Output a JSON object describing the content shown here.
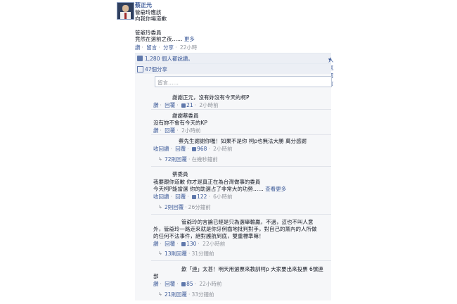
{
  "post": {
    "author": "蔡正元",
    "lines": [
      "管爺玲應該",
      "向我你場道歉",
      "",
      "管爺玲委員",
      "竟然在選前之夜……"
    ],
    "more": "更多",
    "like": "讚",
    "comment": "留言",
    "share": "分享",
    "time": "22小時"
  },
  "stats": {
    "likes_text": "1,280 個人都說讚。",
    "sort_label": "人氣留言",
    "shares_text": "47個分享"
  },
  "comment_box": {
    "placeholder": "留言……"
  },
  "comments": [
    {
      "name": "",
      "text": "謝謝正元，沒有妳沒有今天的柯P",
      "a1": "讚",
      "a2": "回覆",
      "likes": "21",
      "time": "2小時前"
    },
    {
      "name": "",
      "text": "謝謝蔡委員",
      "text2": "沒有妳不會有今天的KP",
      "a1": "讚",
      "a2": "回覆",
      "likes": "",
      "time": "2小時前"
    },
    {
      "name": "",
      "text": "蔡先生謝謝你喔！如果不是你 柯p也無法大勝 萬分感謝",
      "a1": "收回讚",
      "a2": "回覆",
      "likes": "968",
      "time": "2小時前",
      "replies": "72則回覆",
      "reply_time": "在幾秒鐘前"
    },
    {
      "name": "",
      "text": "蔡委員",
      "text2": "我要跟你道歉 你才是真正在為台灣做事的委員",
      "text3": "今天柯P能當選 你的助選占了非常大的功勞……",
      "more": "查看更多",
      "a1": "收回讚",
      "a2": "回覆",
      "likes": "122",
      "time": "6小時前",
      "replies": "2則回覆",
      "reply_time": "26分鐘前"
    },
    {
      "name": "",
      "text": "管爺玲的言論已經是只為選舉輸贏，不過，這也不叫人意",
      "text2": "外，管爺玲一路走來就是你牙例齒地批判對手，對自己的黨內的人所做",
      "text3": "的任何不法事件，絕對護航到底，雙重標準嘛！",
      "a1": "讚",
      "a2": "回覆",
      "likes": "130",
      "time": "22小時前",
      "replies": "13則回覆",
      "reply_time": "31分鐘前"
    },
    {
      "name": "",
      "text": "歎「連」太甚！明天用選票來教訓柯p 大家要出來投票 6號連",
      "text2": "部",
      "a1": "讚",
      "a2": "回覆",
      "likes": "85",
      "time": "22小時前",
      "replies": "21則回覆",
      "reply_time": "33分鐘前"
    }
  ]
}
